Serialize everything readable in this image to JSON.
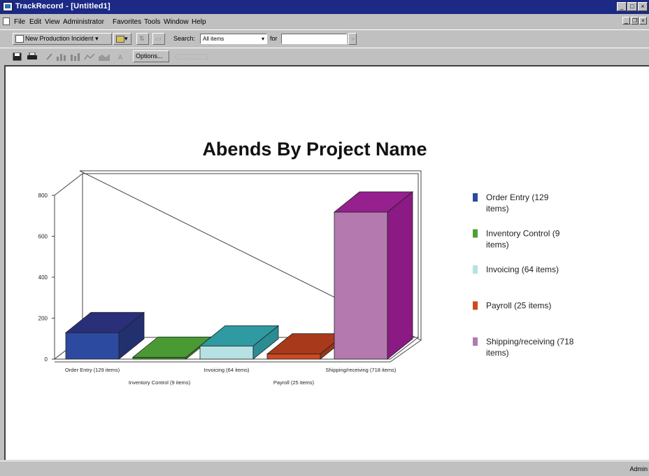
{
  "window": {
    "title": "TrackRecord - [Untitled1]"
  },
  "menu": [
    "File",
    "Edit",
    "View",
    "Administrator",
    "Favorites",
    "Tools",
    "Window",
    "Help"
  ],
  "toolbar": {
    "new_incident_label": "New Production Incident",
    "search_label": "Search:",
    "search_value": "All items",
    "for_label": "for",
    "for_value": "",
    "options_label": "Options..."
  },
  "status": {
    "user": "Admin"
  },
  "colors": {
    "titlebar": "#1c2a86",
    "order_entry": "#2c4aa0",
    "inventory_control": "#3f8c2c",
    "invoicing": "#b6e2e4",
    "payroll": "#cf4a1e",
    "shipping_receiving": "#b47ab0"
  },
  "chart_data": {
    "type": "bar",
    "title": "Abends By Project Name",
    "categories": [
      "Order Entry (129 items)",
      "Inventory Control (9 items)",
      "Invoicing (64 items)",
      "Payroll (25 items)",
      "Shipping/receiving (718 items)"
    ],
    "values": [
      129,
      9,
      64,
      25,
      718
    ],
    "ylim": [
      0,
      800
    ],
    "yticks": [
      0,
      200,
      400,
      600,
      800
    ],
    "legend_position": "right",
    "legend": [
      "Order Entry (129 items)",
      "Inventory Control (9 items)",
      "Invoicing (64 items)",
      "Payroll (25 items)",
      "Shipping/receiving (718 items)"
    ],
    "bar_colors": [
      "#2c4aa0",
      "#3f8c2c",
      "#b6e2e4",
      "#cf4a1e",
      "#b47ab0"
    ],
    "side_colors": [
      "#23306f",
      "#3f8c2c",
      "#2b8c94",
      "#9a3517",
      "#8b1a84"
    ],
    "top_colors": [
      "#2a2f7a",
      "#4a9a34",
      "#2f9aa2",
      "#a8391a",
      "#95208e"
    ],
    "3d": true
  }
}
